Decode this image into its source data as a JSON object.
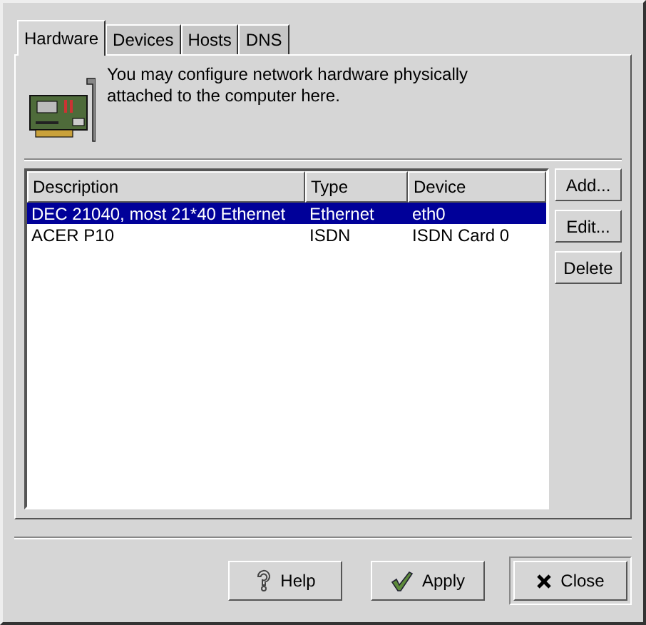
{
  "tabs": [
    {
      "label": "Hardware",
      "selected": true
    },
    {
      "label": "Devices",
      "selected": false
    },
    {
      "label": "Hosts",
      "selected": false
    },
    {
      "label": "DNS",
      "selected": false
    }
  ],
  "intro": "You may configure network hardware physically attached to the computer here.",
  "table": {
    "columns": [
      "Description",
      "Type",
      "Device"
    ],
    "rows": [
      {
        "cells": [
          "DEC 21040, most 21*40 Ethernet",
          "Ethernet",
          "eth0"
        ],
        "selected": true
      },
      {
        "cells": [
          "ACER P10",
          "ISDN",
          "ISDN Card 0"
        ],
        "selected": false
      }
    ]
  },
  "side_buttons": [
    "Add...",
    "Edit...",
    "Delete"
  ],
  "buttons": [
    {
      "label": "Help",
      "kind": "help",
      "default": false
    },
    {
      "label": "Apply",
      "kind": "apply",
      "default": false
    },
    {
      "label": "Close",
      "kind": "close",
      "default": true
    }
  ]
}
